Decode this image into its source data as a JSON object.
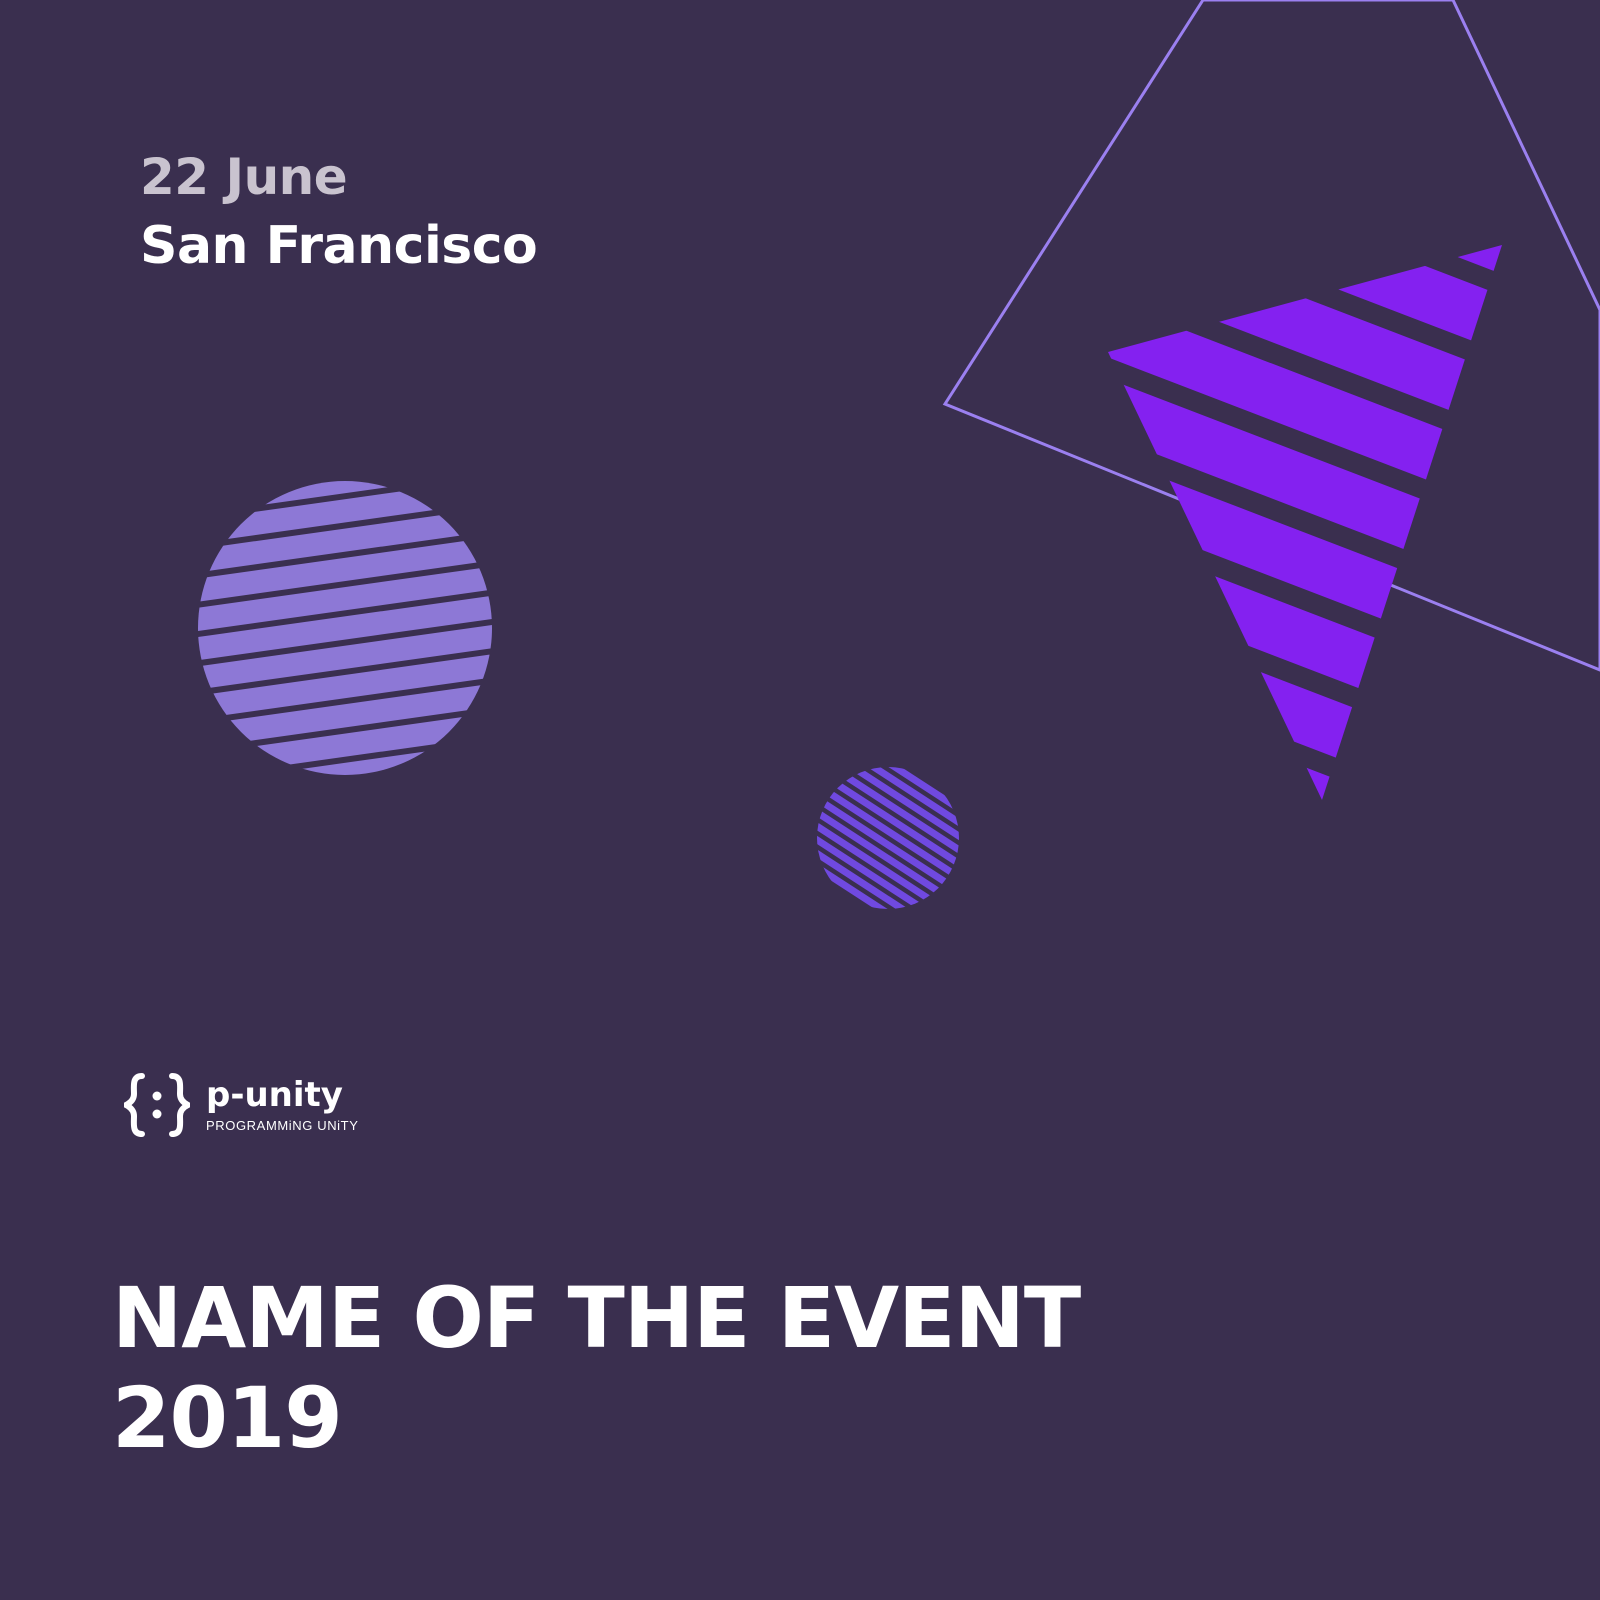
{
  "event": {
    "date": "22 June",
    "city": "San Francisco",
    "title_line1": "NAME OF THE EVENT",
    "title_line2": "2019"
  },
  "brand": {
    "name": "p-unity",
    "tagline": "PROGRAMMiNG UNiTY",
    "logo_icon": "curly-braces-icon"
  },
  "colors": {
    "background": "#3a2f4f",
    "accent_violet": "#8421f0",
    "circle_lavender": "#8d78d6",
    "circle_small": "#7049e0",
    "outline": "#9b80f0"
  }
}
